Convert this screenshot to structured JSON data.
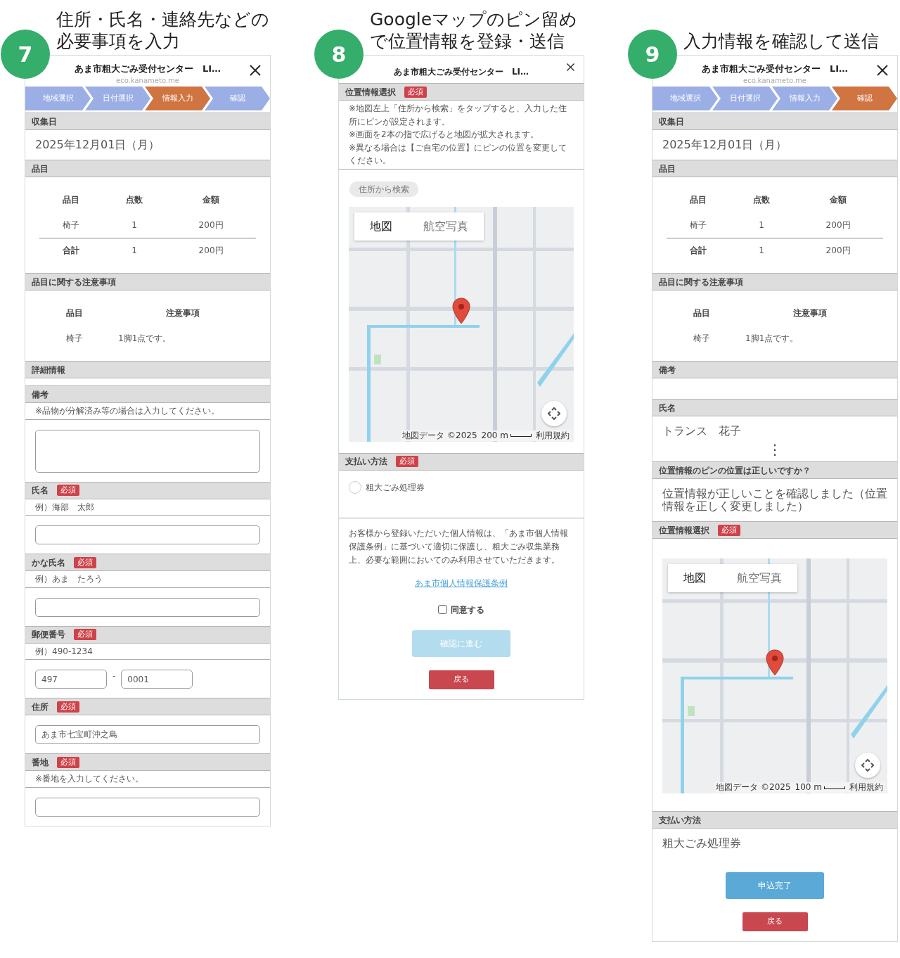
{
  "panels": [
    {
      "number": "7",
      "caption": [
        "住所・氏名・連絡先などの",
        "必要事項を入力"
      ],
      "window": {
        "title": "あま市粗大ごみ受付センター　LI…",
        "url": "eco.kanameto.me"
      },
      "steps": [
        {
          "label": "地域選択",
          "selected": false
        },
        {
          "label": "日付選択",
          "selected": false
        },
        {
          "label": "情報入力",
          "selected": true
        },
        {
          "label": "確認",
          "selected": false
        }
      ],
      "blocks": [
        {
          "kind": "header",
          "title": "収集日"
        },
        {
          "kind": "value",
          "text": "2025年12月01日（月）"
        },
        {
          "kind": "header",
          "title": "品目"
        },
        {
          "kind": "table",
          "columns": [
            "品目",
            "点数",
            "金額"
          ],
          "rows": [
            [
              "椅子",
              "1",
              "200円"
            ]
          ],
          "total": [
            "合計",
            "1",
            "200円"
          ]
        },
        {
          "kind": "header",
          "title": "品目に関する注意事項"
        },
        {
          "kind": "notes_table",
          "columns": [
            "品目",
            "注意事項"
          ],
          "rows": [
            [
              "椅子",
              "1脚1点です。"
            ]
          ]
        },
        {
          "kind": "header",
          "title": "詳細情報"
        },
        {
          "kind": "header",
          "title": "備考"
        },
        {
          "kind": "note",
          "lines": [
            "※品物が分解済み等の場合は入力してください。"
          ]
        },
        {
          "kind": "textarea"
        },
        {
          "kind": "header",
          "title": "氏名",
          "badge": "必須"
        },
        {
          "kind": "note",
          "lines": [
            "例）海部　太郎"
          ]
        },
        {
          "kind": "input"
        },
        {
          "kind": "header",
          "title": "かな氏名",
          "badge": "必須"
        },
        {
          "kind": "note",
          "lines": [
            "例）あま　たろう"
          ]
        },
        {
          "kind": "input"
        },
        {
          "kind": "header",
          "title": "郵便番号",
          "badge": "必須"
        },
        {
          "kind": "note",
          "lines": [
            "例）490-1234"
          ]
        },
        {
          "kind": "postal",
          "values": [
            "497",
            "0001"
          ],
          "separator": "-"
        },
        {
          "kind": "header",
          "title": "住所",
          "badge": "必須"
        },
        {
          "kind": "input",
          "value": "あま市七宝町沖之島"
        },
        {
          "kind": "header",
          "title": "番地",
          "badge": "必須"
        },
        {
          "kind": "note",
          "lines": [
            "※番地を入力してください。"
          ]
        },
        {
          "kind": "input"
        }
      ]
    },
    {
      "number": "8",
      "caption": [
        "Googleマップのピン留め",
        "で位置情報を登録・送信"
      ],
      "window": {
        "title": "あま市粗大ごみ受付センター　LI…"
      },
      "blocks": [
        {
          "kind": "header",
          "title": "位置情報選択",
          "badge": "必須"
        },
        {
          "kind": "note",
          "lines": [
            "※地図左上「住所から検索」をタップすると、入力した住所にピンが設定されます。",
            "※画面を2本の指で広げると地図が拡大されます。",
            "※異なる場合は【ご自宅の位置】にピンの位置を変更してください。"
          ]
        },
        {
          "kind": "map",
          "search_button": "住所から検索",
          "map_types": [
            {
              "label": "地図",
              "selected": true
            },
            {
              "label": "航空写真",
              "selected": false
            }
          ],
          "attribution": [
            {
              "kind": "text",
              "text": "地図データ ©2025"
            },
            {
              "kind": "scale",
              "text": "200 m"
            },
            {
              "kind": "link",
              "text": "利用規約"
            }
          ]
        },
        {
          "kind": "header",
          "title": "支払い方法",
          "badge": "必須"
        },
        {
          "kind": "radio",
          "label": "粗大ごみ処理券",
          "checked": false
        },
        {
          "kind": "consent",
          "text": "お客様から登録いただいた個人情報は、「あま市個人情報保護条例」に基づいて適切に保護し、粗大ごみ収集業務上、必要な範囲においてのみ利用させていただきます。",
          "link": "あま市個人情報保護条例",
          "checkbox": {
            "label": "同意する",
            "checked": false
          }
        },
        {
          "kind": "actions",
          "primary": {
            "label": "確認に進む",
            "disabled": true
          },
          "back": "戻る"
        }
      ]
    },
    {
      "number": "9",
      "caption": [
        "入力情報を確認して送信"
      ],
      "window": {
        "title": "あま市粗大ごみ受付センター　LI…",
        "url": "eco.kanameto.me"
      },
      "steps": [
        {
          "label": "地域選択",
          "selected": false
        },
        {
          "label": "日付選択",
          "selected": false
        },
        {
          "label": "情報入力",
          "selected": false
        },
        {
          "label": "確認",
          "selected": true
        }
      ],
      "blocks": [
        {
          "kind": "header",
          "title": "収集日"
        },
        {
          "kind": "value",
          "text": "2025年12月01日（月）"
        },
        {
          "kind": "header",
          "title": "品目"
        },
        {
          "kind": "table",
          "columns": [
            "品目",
            "点数",
            "金額"
          ],
          "rows": [
            [
              "椅子",
              "1",
              "200円"
            ]
          ],
          "total": [
            "合計",
            "1",
            "200円"
          ]
        },
        {
          "kind": "header",
          "title": "品目に関する注意事項"
        },
        {
          "kind": "notes_table",
          "columns": [
            "品目",
            "注意事項"
          ],
          "rows": [
            [
              "椅子",
              "1脚1点です。"
            ]
          ]
        },
        {
          "kind": "header",
          "title": "備考"
        },
        {
          "kind": "empty"
        },
        {
          "kind": "header",
          "title": "氏名"
        },
        {
          "kind": "value",
          "text": "トランス　花子"
        },
        {
          "kind": "ellipsis",
          "text": "⋮"
        },
        {
          "kind": "header",
          "title": "位置情報のピンの位置は正しいですか？"
        },
        {
          "kind": "value",
          "text": "位置情報が正しいことを確認しました（位置情報を正しく変更しました）"
        },
        {
          "kind": "header",
          "title": "位置情報選択",
          "badge": "必須"
        },
        {
          "kind": "map",
          "map_types": [
            {
              "label": "地図",
              "selected": true
            },
            {
              "label": "航空写真",
              "selected": false
            }
          ],
          "attribution": [
            {
              "kind": "text",
              "text": "地図データ ©2025"
            },
            {
              "kind": "scale",
              "text": "100 m"
            },
            {
              "kind": "link",
              "text": "利用規約"
            }
          ]
        },
        {
          "kind": "header",
          "title": "支払い方法"
        },
        {
          "kind": "value",
          "text": "粗大ごみ処理券"
        },
        {
          "kind": "actions",
          "primary": {
            "label": "申込完了",
            "disabled": false
          },
          "back": "戻る"
        }
      ]
    }
  ]
}
